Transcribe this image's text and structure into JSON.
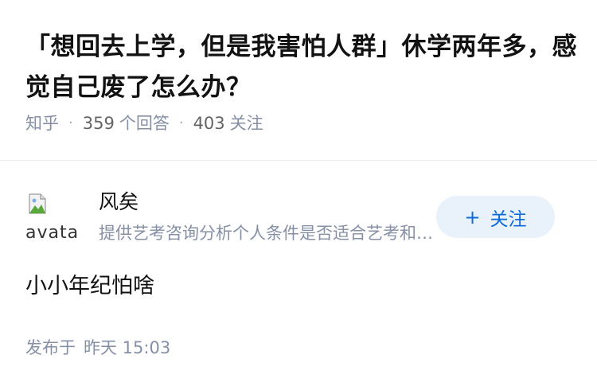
{
  "question": {
    "title": "「想回去上学，但是我害怕人群」休学两年多，感觉自己废了怎么办？",
    "source": "知乎",
    "answer_count": "359",
    "answer_label": "个回答",
    "follower_count": "403",
    "follow_label": "关注"
  },
  "answer": {
    "author": {
      "avatar_alt": "avatar",
      "name": "风矣",
      "headline": "提供艺考咨询分析个人条件是否适合艺考和专业选择"
    },
    "follow_button": {
      "plus": "+",
      "label": "关注"
    },
    "content": "小小年纪怕啥",
    "published_label": "发布于",
    "published_time": "昨天 15:03"
  },
  "colors": {
    "follow_bg": "#e9f1fb",
    "follow_text": "#0d6ad9",
    "meta_text": "#8590a6",
    "title_text": "#121212"
  },
  "icons": {
    "avatar_placeholder": "broken-image-icon",
    "follow": "plus-icon"
  }
}
